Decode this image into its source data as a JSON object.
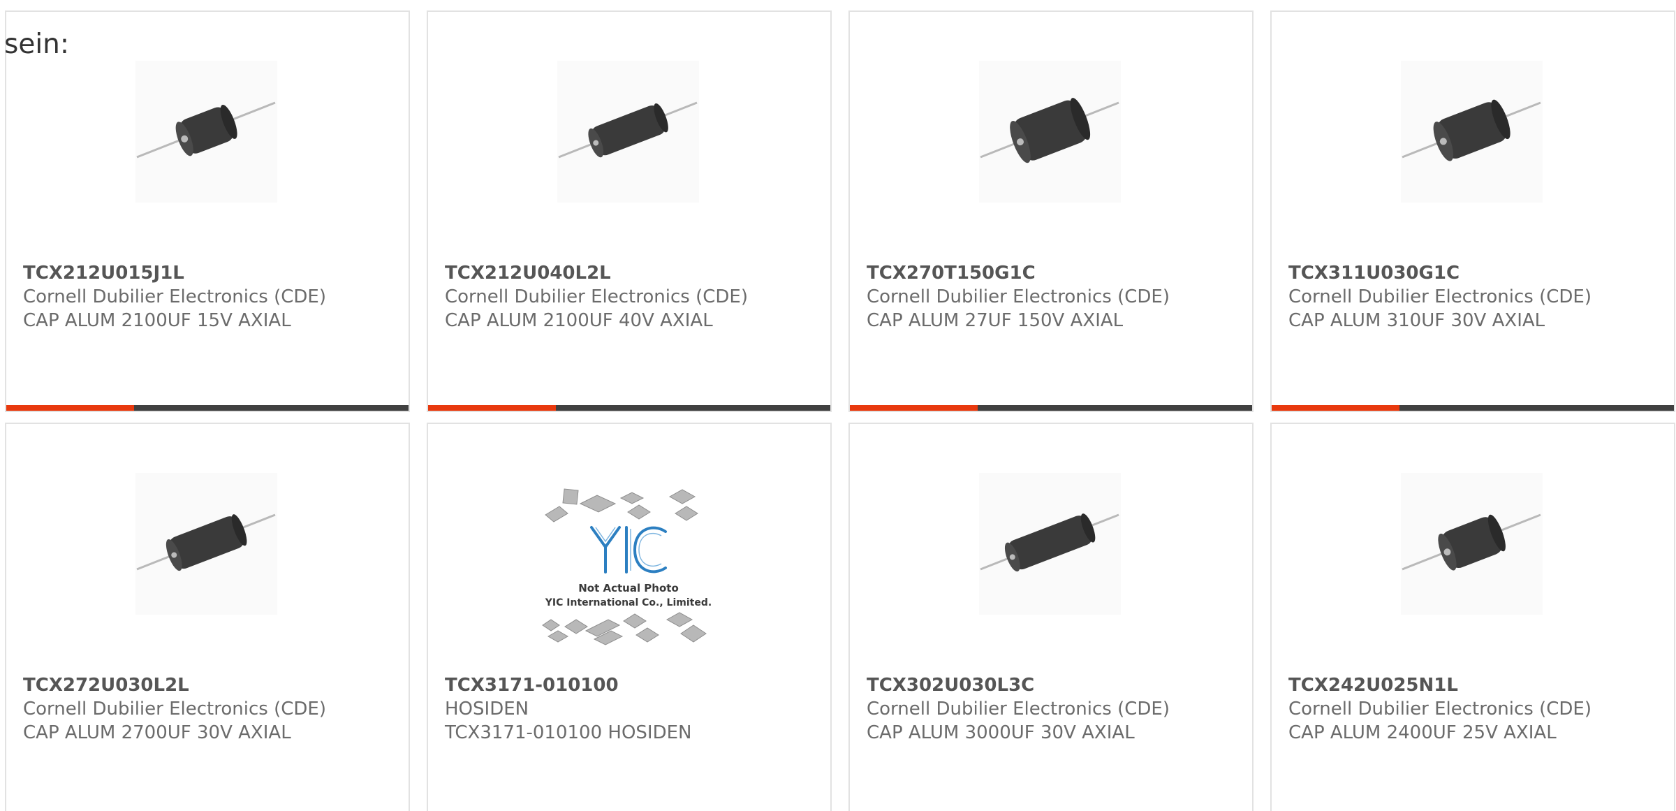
{
  "intro_text": "sein:",
  "colors": {
    "accent": "#e8390e",
    "bar": "#404040",
    "border": "#e2e2e2"
  },
  "products": [
    {
      "part": "TCX212U015J1L",
      "maker": "Cornell Dubilier Electronics (CDE)",
      "desc": "CAP ALUM 2100UF 15V AXIAL",
      "image": "axial-capacitor-icon"
    },
    {
      "part": "TCX212U040L2L",
      "maker": "Cornell Dubilier Electronics (CDE)",
      "desc": "CAP ALUM 2100UF 40V AXIAL",
      "image": "axial-capacitor-icon"
    },
    {
      "part": "TCX270T150G1C",
      "maker": "Cornell Dubilier Electronics (CDE)",
      "desc": "CAP ALUM 27UF 150V AXIAL",
      "image": "axial-capacitor-icon"
    },
    {
      "part": "TCX311U030G1C",
      "maker": "Cornell Dubilier Electronics (CDE)",
      "desc": "CAP ALUM 310UF 30V AXIAL",
      "image": "axial-capacitor-icon"
    },
    {
      "part": "TCX272U030L2L",
      "maker": "Cornell Dubilier Electronics (CDE)",
      "desc": "CAP ALUM 2700UF 30V AXIAL",
      "image": "axial-capacitor-icon"
    },
    {
      "part": "TCX3171-010100",
      "maker": "HOSIDEN",
      "desc": "TCX3171-010100 HOSIDEN",
      "image": "not-actual-photo-placeholder",
      "placeholder_logo": "YIC",
      "placeholder_line1": "Not Actual Photo",
      "placeholder_line2": "YIC International Co., Limited."
    },
    {
      "part": "TCX302U030L3C",
      "maker": "Cornell Dubilier Electronics (CDE)",
      "desc": "CAP ALUM 3000UF 30V AXIAL",
      "image": "axial-capacitor-icon"
    },
    {
      "part": "TCX242U025N1L",
      "maker": "Cornell Dubilier Electronics (CDE)",
      "desc": "CAP ALUM 2400UF 25V AXIAL",
      "image": "axial-capacitor-icon"
    }
  ]
}
